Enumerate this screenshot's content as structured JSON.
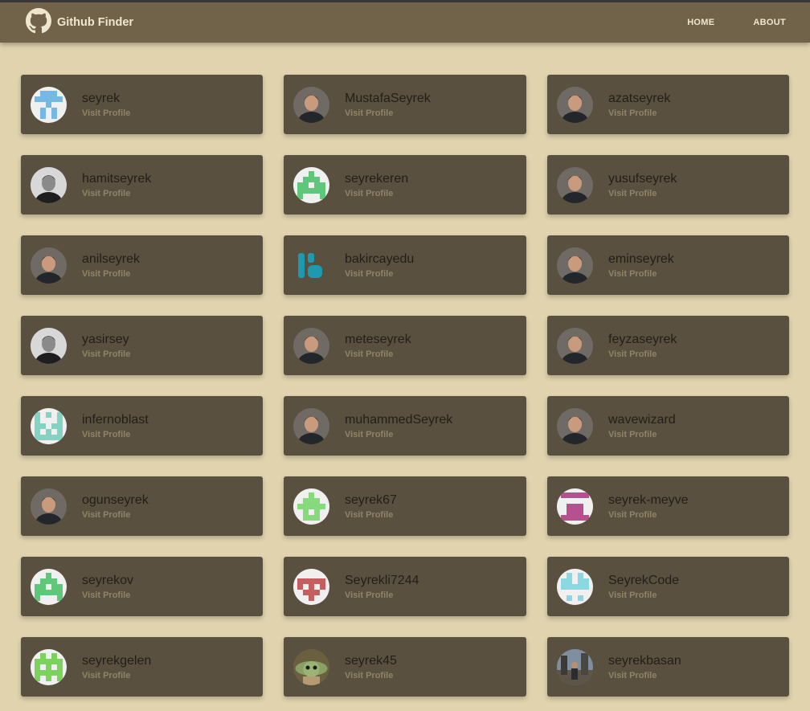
{
  "navbar": {
    "title": "Github Finder",
    "logo_icon": "github-icon",
    "links": [
      "HOME",
      "ABOUT"
    ]
  },
  "colors": {
    "page_bg": "#e0d3ae",
    "navbar_bg": "#716349",
    "card_bg": "#5a503f",
    "username_text": "#231e17",
    "visit_text": "#8f8467"
  },
  "users": [
    {
      "login": "seyrek",
      "link": "Visit Profile",
      "avatar": "identicon-sky-blue"
    },
    {
      "login": "MustafaSeyrek",
      "link": "Visit Profile",
      "avatar": "photo-portrait"
    },
    {
      "login": "azatseyrek",
      "link": "Visit Profile",
      "avatar": "photo-portrait"
    },
    {
      "login": "hamitseyrek",
      "link": "Visit Profile",
      "avatar": "photo-portrait-bw"
    },
    {
      "login": "seyrekeren",
      "link": "Visit Profile",
      "avatar": "identicon-green"
    },
    {
      "login": "yusufseyrek",
      "link": "Visit Profile",
      "avatar": "photo-portrait"
    },
    {
      "login": "anilseyrek",
      "link": "Visit Profile",
      "avatar": "photo-portrait"
    },
    {
      "login": "bakircayedu",
      "link": "Visit Profile",
      "avatar": "logo-teal"
    },
    {
      "login": "eminseyrek",
      "link": "Visit Profile",
      "avatar": "photo-portrait"
    },
    {
      "login": "yasirsey",
      "link": "Visit Profile",
      "avatar": "photo-portrait-bw"
    },
    {
      "login": "meteseyrek",
      "link": "Visit Profile",
      "avatar": "photo-portrait"
    },
    {
      "login": "feyzaseyrek",
      "link": "Visit Profile",
      "avatar": "photo-portrait"
    },
    {
      "login": "infernoblast",
      "link": "Visit Profile",
      "avatar": "identicon-mint"
    },
    {
      "login": "muhammedSeyrek",
      "link": "Visit Profile",
      "avatar": "photo-portrait"
    },
    {
      "login": "wavewizard",
      "link": "Visit Profile",
      "avatar": "photo-portrait"
    },
    {
      "login": "ogunseyrek",
      "link": "Visit Profile",
      "avatar": "photo-portrait"
    },
    {
      "login": "seyrek67",
      "link": "Visit Profile",
      "avatar": "identicon-light-green"
    },
    {
      "login": "seyrek-meyve",
      "link": "Visit Profile",
      "avatar": "identicon-magenta"
    },
    {
      "login": "seyrekov",
      "link": "Visit Profile",
      "avatar": "identicon-green"
    },
    {
      "login": "Seyrekli7244",
      "link": "Visit Profile",
      "avatar": "identicon-red"
    },
    {
      "login": "SeyrekCode",
      "link": "Visit Profile",
      "avatar": "identicon-aqua"
    },
    {
      "login": "seyrekgelen",
      "link": "Visit Profile",
      "avatar": "identicon-lime"
    },
    {
      "login": "seyrek45",
      "link": "Visit Profile",
      "avatar": "photo-baby-yoda"
    },
    {
      "login": "seyrekbasan",
      "link": "Visit Profile",
      "avatar": "photo-street"
    }
  ]
}
